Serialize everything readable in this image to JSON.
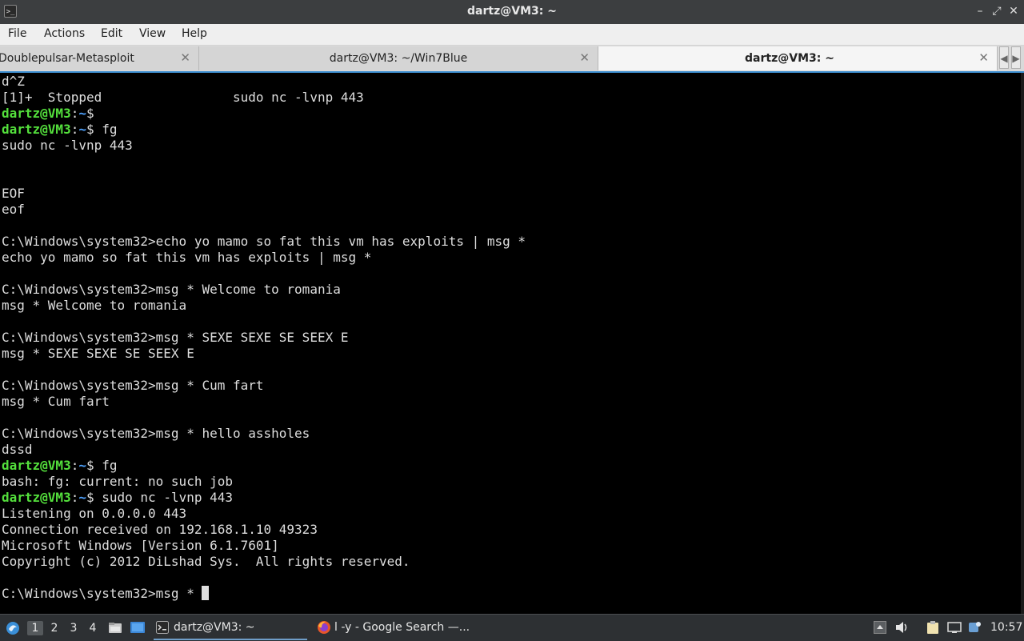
{
  "window": {
    "title": "dartz@VM3: ~",
    "controls": {
      "minimize": "–",
      "maximize": "⤢",
      "close": "✕"
    }
  },
  "menu": [
    "File",
    "Actions",
    "Edit",
    "View",
    "Help"
  ],
  "tabs": [
    {
      "label": "Doublepulsar-Metasploit",
      "active": false
    },
    {
      "label": "dartz@VM3: ~/Win7Blue",
      "active": false
    },
    {
      "label": "dartz@VM3: ~",
      "active": true
    }
  ],
  "tab_close_glyph": "✕",
  "prompt": {
    "user": "dartz@VM3",
    "colon": ":",
    "path": "~",
    "symbol": "$ "
  },
  "terminal_lines": [
    {
      "text": "d^Z"
    },
    {
      "text": "[1]+  Stopped                 sudo nc -lvnp 443"
    },
    {
      "prompt": true,
      "text": ""
    },
    {
      "prompt": true,
      "text": "fg"
    },
    {
      "text": "sudo nc -lvnp 443"
    },
    {
      "text": ""
    },
    {
      "text": ""
    },
    {
      "text": "EOF"
    },
    {
      "text": "eof"
    },
    {
      "text": ""
    },
    {
      "text": "C:\\Windows\\system32>echo yo mamo so fat this vm has exploits | msg *"
    },
    {
      "text": "echo yo mamo so fat this vm has exploits | msg *"
    },
    {
      "text": ""
    },
    {
      "text": "C:\\Windows\\system32>msg * Welcome to romania"
    },
    {
      "text": "msg * Welcome to romania"
    },
    {
      "text": ""
    },
    {
      "text": "C:\\Windows\\system32>msg * SEXE SEXE SE SEEX E"
    },
    {
      "text": "msg * SEXE SEXE SE SEEX E"
    },
    {
      "text": ""
    },
    {
      "text": "C:\\Windows\\system32>msg * Cum fart"
    },
    {
      "text": "msg * Cum fart"
    },
    {
      "text": ""
    },
    {
      "text": "C:\\Windows\\system32>msg * hello assholes"
    },
    {
      "text": "dssd"
    },
    {
      "prompt": true,
      "text": "fg"
    },
    {
      "text": "bash: fg: current: no such job"
    },
    {
      "prompt": true,
      "text": "sudo nc -lvnp 443"
    },
    {
      "text": "Listening on 0.0.0.0 443"
    },
    {
      "text": "Connection received on 192.168.1.10 49323"
    },
    {
      "text": "Microsoft Windows [Version 6.1.7601]"
    },
    {
      "text": "Copyright (c) 2012 DiLshad Sys.  All rights reserved."
    },
    {
      "text": ""
    },
    {
      "text": "C:\\Windows\\system32>msg * ",
      "cursor": true
    }
  ],
  "taskbar": {
    "workspaces": [
      "1",
      "2",
      "3",
      "4"
    ],
    "active_workspace": "1",
    "tasks": [
      {
        "label": "dartz@VM3: ~",
        "icon": "terminal-icon",
        "active": true
      },
      {
        "label": "l -y - Google Search —...",
        "icon": "firefox-icon",
        "active": false
      }
    ],
    "clock": "10:57"
  },
  "colors": {
    "prompt_user": "#54e03c",
    "prompt_path": "#4fa3ff",
    "terminal_text": "#dedede",
    "accent": "#3d8fd1"
  }
}
